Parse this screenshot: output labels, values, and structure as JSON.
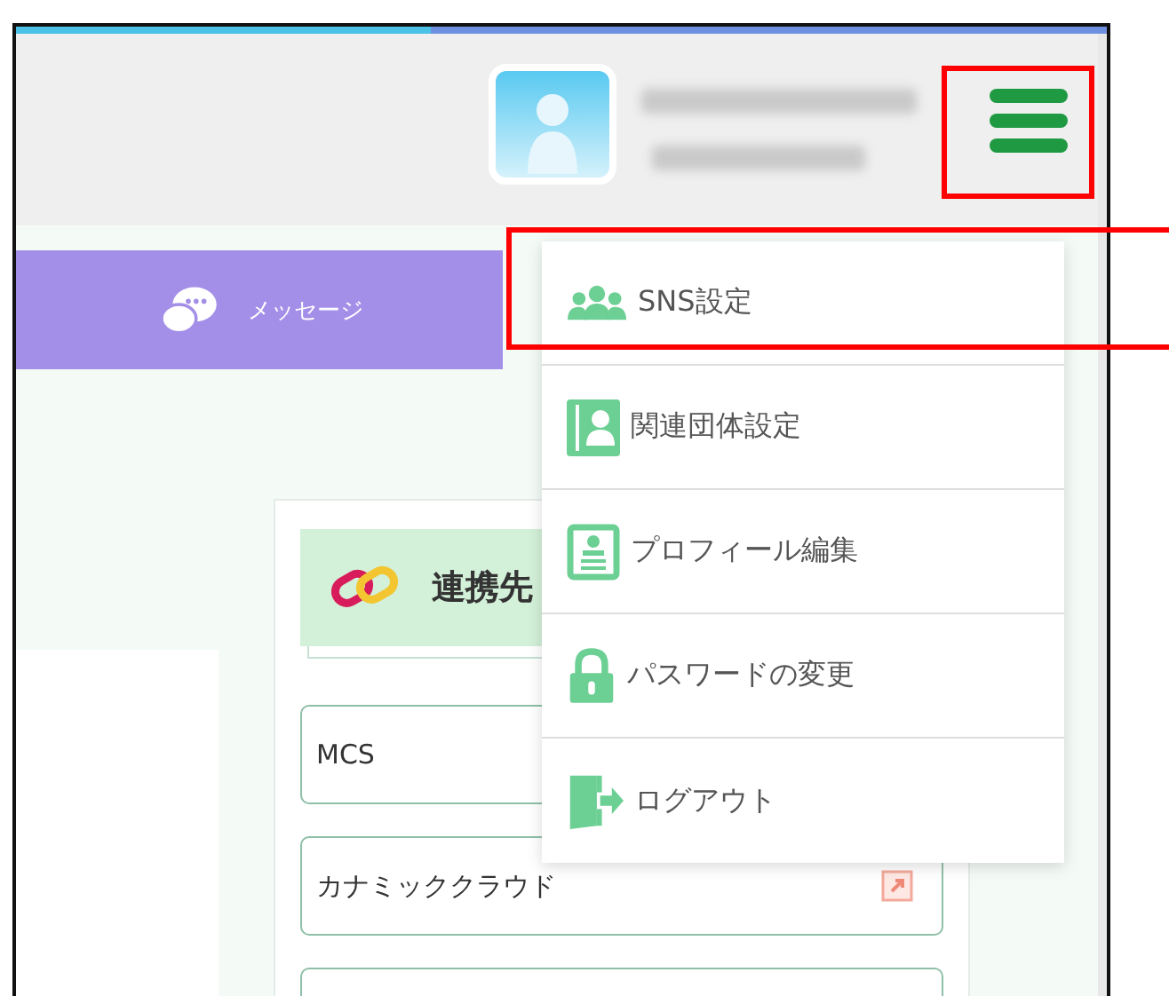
{
  "nav": [
    {
      "label": "メッセージ"
    }
  ],
  "menu": {
    "items": [
      {
        "label": "SNS設定",
        "kind": "group"
      },
      {
        "label": "関連団体設定",
        "kind": "contacts"
      },
      {
        "label": "プロフィール編集",
        "kind": "profile"
      },
      {
        "label": "パスワードの変更",
        "kind": "lock"
      },
      {
        "label": "ログアウト",
        "kind": "logout"
      }
    ]
  },
  "card": {
    "title": "連携先",
    "links": [
      {
        "label": "MCS"
      },
      {
        "label": "カナミッククラウド",
        "external": true
      }
    ]
  }
}
